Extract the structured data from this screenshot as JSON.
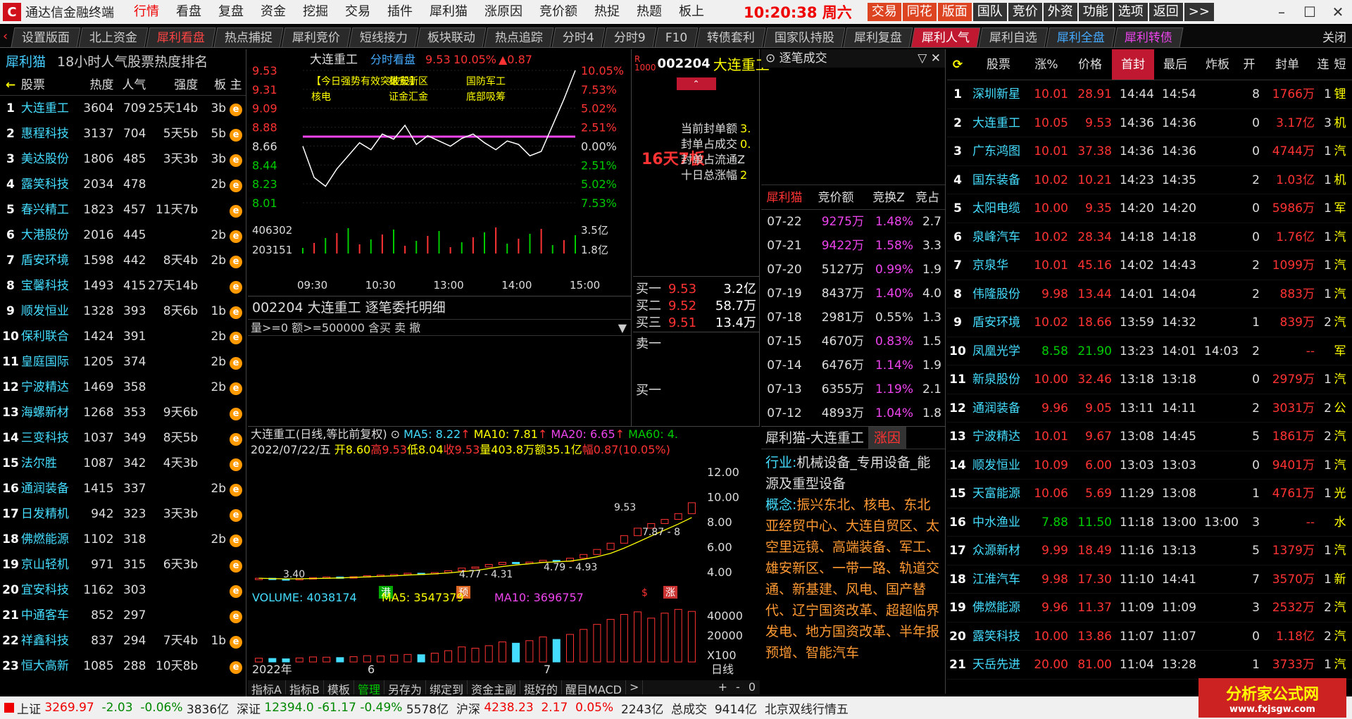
{
  "menubar": {
    "logo": "C",
    "app_name": "通达信金融终端",
    "menu": [
      "行情",
      "看盘",
      "复盘",
      "资金",
      "挖掘",
      "交易",
      "插件",
      "犀利猫",
      "涨原因",
      "竞价额",
      "热捉",
      "热题",
      "板上"
    ],
    "time": "10:20:38",
    "weekday": "周六",
    "right_buttons": [
      "交易",
      "同花",
      "版面",
      "国队",
      "竞价",
      "外资",
      "功能",
      "选项",
      "返回",
      ">>"
    ]
  },
  "tabs": [
    "设置版面",
    "北上资金",
    "犀利看盘",
    "热点捕捉",
    "犀利竞价",
    "短线接力",
    "板块联动",
    "热点追踪",
    "分时4",
    "分时9",
    "F10",
    "转债套利",
    "国家队持股",
    "犀利复盘",
    "犀利人气",
    "犀利自选",
    "犀利全盘",
    "犀利转债"
  ],
  "tab_close": "关闭",
  "left_panel": {
    "title_prefix": "犀利猫",
    "title": "18小时人气股票热度排名",
    "headers": [
      "股票",
      "热度",
      "人气",
      "强度",
      "板",
      "主"
    ],
    "rows": [
      {
        "no": "1",
        "name": "大连重工",
        "hot": "3604",
        "pop": "709",
        "str": "25天14b",
        "bd": "3b"
      },
      {
        "no": "2",
        "name": "惠程科技",
        "hot": "3137",
        "pop": "704",
        "str": "5天5b",
        "bd": "5b"
      },
      {
        "no": "3",
        "name": "美达股份",
        "hot": "1806",
        "pop": "485",
        "str": "3天3b",
        "bd": "3b"
      },
      {
        "no": "4",
        "name": "露笑科技",
        "hot": "2034",
        "pop": "478",
        "str": "",
        "bd": "2b"
      },
      {
        "no": "5",
        "name": "春兴精工",
        "hot": "1823",
        "pop": "457",
        "str": "11天7b",
        "bd": ""
      },
      {
        "no": "6",
        "name": "大港股份",
        "hot": "2016",
        "pop": "445",
        "str": "",
        "bd": "2b"
      },
      {
        "no": "7",
        "name": "盾安环境",
        "hot": "1598",
        "pop": "442",
        "str": "8天4b",
        "bd": "2b"
      },
      {
        "no": "8",
        "name": "宝馨科技",
        "hot": "1493",
        "pop": "415",
        "str": "27天14b",
        "bd": ""
      },
      {
        "no": "9",
        "name": "顺发恒业",
        "hot": "1328",
        "pop": "393",
        "str": "8天6b",
        "bd": "1b"
      },
      {
        "no": "10",
        "name": "保利联合",
        "hot": "1424",
        "pop": "391",
        "str": "",
        "bd": "2b"
      },
      {
        "no": "11",
        "name": "皇庭国际",
        "hot": "1205",
        "pop": "374",
        "str": "",
        "bd": "2b"
      },
      {
        "no": "12",
        "name": "宁波精达",
        "hot": "1469",
        "pop": "358",
        "str": "",
        "bd": "2b"
      },
      {
        "no": "13",
        "name": "海螺新材",
        "hot": "1268",
        "pop": "353",
        "str": "9天6b",
        "bd": ""
      },
      {
        "no": "14",
        "name": "三变科技",
        "hot": "1037",
        "pop": "349",
        "str": "8天5b",
        "bd": ""
      },
      {
        "no": "15",
        "name": "法尔胜",
        "hot": "1087",
        "pop": "342",
        "str": "4天3b",
        "bd": ""
      },
      {
        "no": "16",
        "name": "通润装备",
        "hot": "1415",
        "pop": "337",
        "str": "",
        "bd": "2b"
      },
      {
        "no": "17",
        "name": "日发精机",
        "hot": "942",
        "pop": "323",
        "str": "3天3b",
        "bd": ""
      },
      {
        "no": "18",
        "name": "佛燃能源",
        "hot": "1102",
        "pop": "318",
        "str": "",
        "bd": "2b"
      },
      {
        "no": "19",
        "name": "京山轻机",
        "hot": "971",
        "pop": "315",
        "str": "6天3b",
        "bd": ""
      },
      {
        "no": "20",
        "name": "宜安科技",
        "hot": "1162",
        "pop": "303",
        "str": "",
        "bd": ""
      },
      {
        "no": "21",
        "name": "中通客车",
        "hot": "852",
        "pop": "297",
        "str": "",
        "bd": ""
      },
      {
        "no": "22",
        "name": "祥鑫科技",
        "hot": "837",
        "pop": "294",
        "str": "7天4b",
        "bd": "1b"
      },
      {
        "no": "23",
        "name": "恒大高新",
        "hot": "1085",
        "pop": "288",
        "str": "10天8b",
        "bd": ""
      }
    ]
  },
  "intraday": {
    "name": "大连重工",
    "mode": "分时看盘",
    "price": "9.53",
    "pct": "10.05%",
    "chg": "▲0.87",
    "y_left": [
      "9.53",
      "9.31",
      "9.09",
      "8.88",
      "8.66",
      "8.44",
      "8.23",
      "8.01"
    ],
    "y_right": [
      "10.05%",
      "7.53%",
      "5.02%",
      "2.51%",
      "0.00%",
      "2.51%",
      "5.02%",
      "7.53%"
    ],
    "vol_left": [
      "406302",
      "203151"
    ],
    "vol_right": [
      "3.5亿",
      "1.8亿"
    ],
    "x_ticks": [
      "09:30",
      "10:30",
      "13:00",
      "14:00",
      "15:00"
    ],
    "series_minutes": [
      0,
      10,
      20,
      30,
      40,
      50,
      60,
      70,
      80,
      90,
      100,
      110,
      120,
      130,
      140,
      150,
      160,
      170,
      180,
      190,
      200,
      210,
      220,
      230,
      240
    ],
    "series_price": [
      8.66,
      8.3,
      8.2,
      8.4,
      8.55,
      8.7,
      8.62,
      8.8,
      8.74,
      8.9,
      8.68,
      8.78,
      8.72,
      8.66,
      8.75,
      8.8,
      8.7,
      8.62,
      8.72,
      8.68,
      8.55,
      8.6,
      8.9,
      9.2,
      9.53
    ],
    "annotations": [
      "【今日强势有效突破股】",
      "雄安新区",
      "国防军工",
      "核电",
      "证金汇金",
      "底部吸筹"
    ]
  },
  "detail": {
    "title_code": "002204",
    "title_name": "大连重工",
    "title_text": "逐笔委托明细",
    "filter": "量>=0 额>=500000 含买 卖 撤"
  },
  "quote": {
    "code": "002204",
    "name": "大连重工",
    "days_label": "16天7板",
    "info_labels": [
      "当前封单额",
      "封单占成交",
      "封单占流通Z",
      "十日总涨幅"
    ],
    "info_values": [
      "3.",
      "0.",
      "",
      "2"
    ],
    "bids": [
      {
        "label": "买一",
        "price": "9.53",
        "vol": "3.2亿"
      },
      {
        "label": "买二",
        "price": "9.52",
        "vol": "58.7万"
      },
      {
        "label": "买三",
        "price": "9.51",
        "vol": "13.4万"
      }
    ],
    "ask_label": "卖一",
    "bid_label2": "买一"
  },
  "tick": {
    "title": "逐笔成交",
    "headers": [
      "犀利猫",
      "竞价额",
      "竞换Z",
      "竞占"
    ],
    "rows": [
      {
        "date": "07-22",
        "amt": "9275万",
        "pct": "1.48%",
        "r": "2.7"
      },
      {
        "date": "07-21",
        "amt": "9422万",
        "pct": "1.58%",
        "r": "3.3"
      },
      {
        "date": "07-20",
        "amt": "5127万",
        "pct": "0.99%",
        "r": "1.9"
      },
      {
        "date": "07-19",
        "amt": "8437万",
        "pct": "1.40%",
        "r": "4.0"
      },
      {
        "date": "07-18",
        "amt": "2981万",
        "pct": "0.55%",
        "r": "1.3"
      },
      {
        "date": "07-15",
        "amt": "4670万",
        "pct": "0.83%",
        "r": "1.5"
      },
      {
        "date": "07-14",
        "amt": "6476万",
        "pct": "1.14%",
        "r": "1.9"
      },
      {
        "date": "07-13",
        "amt": "6355万",
        "pct": "1.19%",
        "r": "2.1"
      },
      {
        "date": "07-12",
        "amt": "4893万",
        "pct": "1.04%",
        "r": "1.8"
      }
    ]
  },
  "kline": {
    "title": "大连重工(日线,等比前复权)",
    "ma5": "MA5: 8.22",
    "ma10": "MA10: 7.81",
    "ma20": "MA20: 6.65",
    "ma60": "MA60: 4.",
    "date": "2022/07/22/五",
    "open": "开8.60",
    "high": "高9.53",
    "low": "低8.04",
    "close": "收9.53",
    "vol": "量403.8万",
    "amount": "额35.1亿",
    "range": "幅0.87(10.05%)",
    "y_ticks": [
      "12.00",
      "10.00",
      "8.00",
      "6.00",
      "4.00"
    ],
    "labels": [
      "9.53",
      "7.87 - 8",
      "3.40",
      "4.77 - 4.31",
      "4.79 - 4.93"
    ],
    "markers": [
      "港",
      "预",
      "$",
      "涨"
    ],
    "closes": [
      3.5,
      3.45,
      3.4,
      3.48,
      3.55,
      3.6,
      3.58,
      3.62,
      3.7,
      3.75,
      3.8,
      3.9,
      3.85,
      3.95,
      4.1,
      4.31,
      4.4,
      4.6,
      4.77,
      4.7,
      4.79,
      4.93,
      4.85,
      5.1,
      5.4,
      5.8,
      6.3,
      6.9,
      7.5,
      7.87,
      8.2,
      8.66,
      9.53
    ],
    "volume_title": "VOLUME: 4038174",
    "vol_ma5": "MA5: 3547379",
    "vol_ma10": "MA10: 3696757",
    "vol_ticks": [
      "40000",
      "20000",
      "X100"
    ],
    "volumes": [
      300,
      280,
      250,
      320,
      400,
      380,
      350,
      420,
      500,
      480,
      550,
      600,
      580,
      700,
      900,
      1200,
      1100,
      1300,
      1600,
      1500,
      1700,
      2000,
      1800,
      2200,
      2600,
      3000,
      3400,
      3800,
      4000,
      3500,
      3900,
      4200,
      4038
    ],
    "x_labels": [
      "2022年",
      "6",
      "7"
    ],
    "period": "日线",
    "bottom_tabs": [
      "指标A",
      "指标B",
      "模板",
      "管理",
      "另存为",
      "绑定到",
      "资金主副",
      "挺好的",
      "醒目MACD",
      ">"
    ],
    "bottom_tools": [
      "+",
      "-",
      "0"
    ]
  },
  "concept": {
    "title": "犀利猫-大连重工",
    "tag": "涨因",
    "industry_label": "行业:",
    "industry": "机械设备_专用设备_能源及重型设备",
    "concept_label": "概念:",
    "concepts": "振兴东北、核电、东北亚经贸中心、大连自贸区、太空里远镜、高端装备、军工、雄安新区、一带一路、轨道交通、新基建、风电、国产替代、辽宁国资改革、超超临界发电、地方国资改革、半年报预增、智能汽车"
  },
  "right_panel": {
    "headers": [
      "股票",
      "涨%",
      "价格",
      "首封",
      "最后",
      "炸板",
      "开",
      "封单",
      "连",
      "短"
    ],
    "rows": [
      {
        "no": "1",
        "name": "深圳新星",
        "pct": "10.01",
        "price": "28.91",
        "first": "14:44",
        "last": "14:54",
        "brk": "",
        "open": "8",
        "seal": "1766万",
        "lian": "1",
        "dsc": "锂"
      },
      {
        "no": "2",
        "name": "大连重工",
        "pct": "10.05",
        "price": "9.53",
        "first": "14:36",
        "last": "14:36",
        "brk": "",
        "open": "0",
        "seal": "3.17亿",
        "lian": "3",
        "dsc": "机"
      },
      {
        "no": "3",
        "name": "广东鸿图",
        "pct": "10.01",
        "price": "37.38",
        "first": "14:36",
        "last": "14:36",
        "brk": "",
        "open": "0",
        "seal": "4744万",
        "lian": "1",
        "dsc": "汽"
      },
      {
        "no": "4",
        "name": "国东装备",
        "pct": "10.02",
        "price": "10.21",
        "first": "14:23",
        "last": "14:35",
        "brk": "",
        "open": "2",
        "seal": "1.03亿",
        "lian": "1",
        "dsc": "机"
      },
      {
        "no": "5",
        "name": "太阳电缆",
        "pct": "10.00",
        "price": "9.35",
        "first": "14:20",
        "last": "14:20",
        "brk": "",
        "open": "0",
        "seal": "5986万",
        "lian": "1",
        "dsc": "军"
      },
      {
        "no": "6",
        "name": "泉峰汽车",
        "pct": "10.02",
        "price": "28.34",
        "first": "14:18",
        "last": "14:18",
        "brk": "",
        "open": "0",
        "seal": "1.76亿",
        "lian": "1",
        "dsc": "汽"
      },
      {
        "no": "7",
        "name": "京泉华",
        "pct": "10.01",
        "price": "45.16",
        "first": "14:02",
        "last": "14:43",
        "brk": "",
        "open": "2",
        "seal": "1099万",
        "lian": "1",
        "dsc": "汽"
      },
      {
        "no": "8",
        "name": "伟隆股份",
        "pct": "9.98",
        "price": "13.44",
        "first": "14:01",
        "last": "14:04",
        "brk": "",
        "open": "2",
        "seal": "883万",
        "lian": "1",
        "dsc": "汽"
      },
      {
        "no": "9",
        "name": "盾安环境",
        "pct": "10.02",
        "price": "18.66",
        "first": "13:59",
        "last": "14:32",
        "brk": "",
        "open": "1",
        "seal": "839万",
        "lian": "2",
        "dsc": "汽"
      },
      {
        "no": "10",
        "name": "凤凰光学",
        "pct": "8.58",
        "price": "21.90",
        "first": "13:23",
        "last": "14:01",
        "brk": "14:03",
        "open": "2",
        "seal": "--",
        "lian": "",
        "dsc": "军"
      },
      {
        "no": "11",
        "name": "新泉股份",
        "pct": "10.00",
        "price": "32.46",
        "first": "13:18",
        "last": "13:18",
        "brk": "",
        "open": "0",
        "seal": "2979万",
        "lian": "1",
        "dsc": "汽"
      },
      {
        "no": "12",
        "name": "通润装备",
        "pct": "9.96",
        "price": "9.05",
        "first": "13:11",
        "last": "14:11",
        "brk": "",
        "open": "2",
        "seal": "3031万",
        "lian": "2",
        "dsc": "公"
      },
      {
        "no": "13",
        "name": "宁波精达",
        "pct": "10.01",
        "price": "9.67",
        "first": "13:08",
        "last": "14:45",
        "brk": "",
        "open": "5",
        "seal": "1861万",
        "lian": "2",
        "dsc": "汽"
      },
      {
        "no": "14",
        "name": "顺发恒业",
        "pct": "10.09",
        "price": "6.00",
        "first": "13:03",
        "last": "13:03",
        "brk": "",
        "open": "0",
        "seal": "9401万",
        "lian": "1",
        "dsc": "汽"
      },
      {
        "no": "15",
        "name": "天富能源",
        "pct": "10.06",
        "price": "5.69",
        "first": "11:29",
        "last": "13:08",
        "brk": "",
        "open": "1",
        "seal": "4761万",
        "lian": "1",
        "dsc": "光"
      },
      {
        "no": "16",
        "name": "中水渔业",
        "pct": "7.88",
        "price": "11.50",
        "first": "11:18",
        "last": "13:00",
        "brk": "13:00",
        "open": "3",
        "seal": "--",
        "lian": "",
        "dsc": "水"
      },
      {
        "no": "17",
        "name": "众源新材",
        "pct": "9.99",
        "price": "18.49",
        "first": "11:16",
        "last": "13:13",
        "brk": "",
        "open": "5",
        "seal": "1379万",
        "lian": "1",
        "dsc": "汽"
      },
      {
        "no": "18",
        "name": "江淮汽车",
        "pct": "9.98",
        "price": "17.30",
        "first": "11:10",
        "last": "14:41",
        "brk": "",
        "open": "7",
        "seal": "3570万",
        "lian": "1",
        "dsc": "新"
      },
      {
        "no": "19",
        "name": "佛燃能源",
        "pct": "9.96",
        "price": "11.37",
        "first": "11:09",
        "last": "11:09",
        "brk": "",
        "open": "3",
        "seal": "2532万",
        "lian": "2",
        "dsc": "汽"
      },
      {
        "no": "20",
        "name": "露笑科技",
        "pct": "10.00",
        "price": "13.86",
        "first": "11:07",
        "last": "11:07",
        "brk": "",
        "open": "0",
        "seal": "1.18亿",
        "lian": "2",
        "dsc": "汽"
      },
      {
        "no": "21",
        "name": "天岳先进",
        "pct": "20.00",
        "price": "81.00",
        "first": "11:04",
        "last": "13:28",
        "brk": "",
        "open": "1",
        "seal": "3733万",
        "lian": "1",
        "dsc": "汽"
      }
    ]
  },
  "status": {
    "sh_label": "上证",
    "sh": "3269.97",
    "sh_chg": "-2.03",
    "sh_pct": "-0.06%",
    "sh_amt": "3836亿",
    "sz_label": "深证",
    "sz": "12394.0",
    "sz_chg": "-61.17",
    "sz_pct": "-0.49%",
    "sz_amt": "5578亿",
    "hs_label": "沪深",
    "hs": "4238.23",
    "hs_chg": "2.17",
    "hs_pct": "0.05%",
    "hs_amt": "2243亿",
    "total_label": "总成交",
    "total": "9414亿",
    "server": "北京双线行情五"
  },
  "watermark": {
    "text": "分析家公式网",
    "url": "www.fxjsgw.com"
  },
  "colors": {
    "up": "#ff3333",
    "down": "#00cc00",
    "accent": "#c01830",
    "name": "#44ddff",
    "yellow": "#ffff00"
  }
}
